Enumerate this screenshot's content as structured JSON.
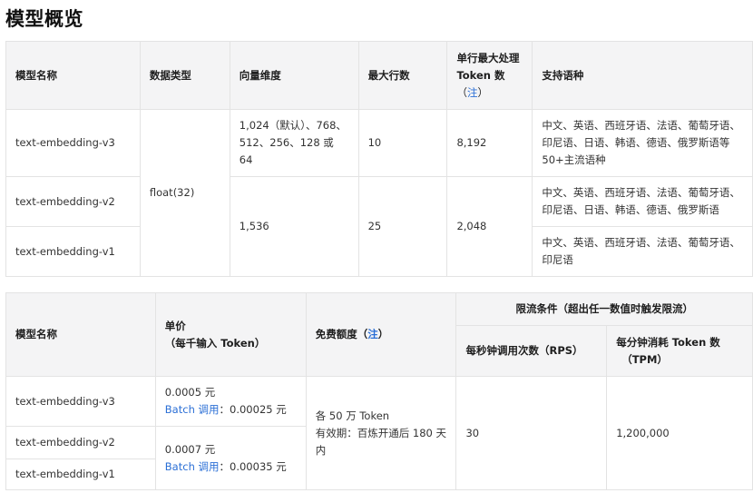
{
  "page": {
    "title": "模型概览"
  },
  "table1": {
    "headers": {
      "model_name": "模型名称",
      "data_type": "数据类型",
      "vector_dim": "向量维度",
      "max_rows": "最大行数",
      "max_tokens_line1": "单行最大处理",
      "max_tokens_line2": "Token 数",
      "note_open": "（",
      "note_link": "注",
      "note_close": "）",
      "languages": "支持语种"
    },
    "rows": [
      {
        "model": "text-embedding-v3"
      },
      {
        "model": "text-embedding-v2"
      },
      {
        "model": "text-embedding-v1"
      }
    ],
    "data_type_value": "float(32)",
    "v3": {
      "dimensions": "1,024（默认）、768、512、256、128 或 64",
      "max_rows": "10",
      "max_tokens": "8,192",
      "languages": "中文、英语、西班牙语、法语、葡萄牙语、印尼语、日语、韩语、德语、俄罗斯语等50+主流语种"
    },
    "v2v1": {
      "dimensions": "1,536",
      "max_rows": "25",
      "max_tokens": "2,048"
    },
    "v2_languages": "中文、英语、西班牙语、法语、葡萄牙语、印尼语、日语、韩语、德语、俄罗斯语",
    "v1_languages": "中文、英语、西班牙语、法语、葡萄牙语、印尼语"
  },
  "table2": {
    "headers": {
      "model_name": "模型名称",
      "price_line1": "单价",
      "price_line2": "（每千输入 Token）",
      "free_quota": "免费额度（",
      "free_quota_link": "注",
      "free_quota_close": "）",
      "rate_limit": "限流条件（超出任一数值时触发限流）",
      "rps": "每秒钟调用次数（RPS）",
      "tpm_line1": "每分钟消耗 Token 数",
      "tpm_line2": "（TPM）"
    },
    "rows": [
      {
        "model": "text-embedding-v3"
      },
      {
        "model": "text-embedding-v2"
      },
      {
        "model": "text-embedding-v1"
      }
    ],
    "v3_price": "0.0005 元",
    "v3_batch_link": "Batch 调用",
    "v3_batch_price": "：0.00025 元",
    "v2v1_price": "0.0007 元",
    "v2v1_batch_link": "Batch 调用",
    "v2v1_batch_price": "：0.00035 元",
    "free_quota_line1": "各 50 万 Token",
    "free_quota_line2": "有效期：百炼开通后 180 天内",
    "rps_value": "30",
    "tpm_value": "1,200,000"
  }
}
